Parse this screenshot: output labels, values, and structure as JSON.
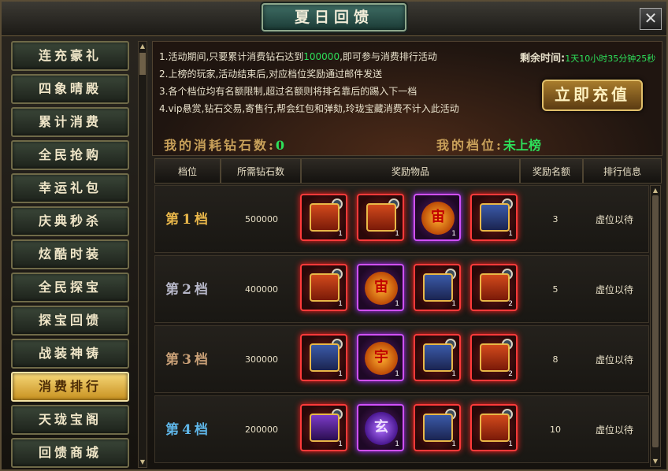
{
  "window": {
    "title": "夏日回馈",
    "close_label": "✕"
  },
  "menu": {
    "items": [
      {
        "label": "连充豪礼",
        "active": false
      },
      {
        "label": "四象晴殿",
        "active": false
      },
      {
        "label": "累计消费",
        "active": false
      },
      {
        "label": "全民抢购",
        "active": false
      },
      {
        "label": "幸运礼包",
        "active": false
      },
      {
        "label": "庆典秒杀",
        "active": false
      },
      {
        "label": "炫酷时装",
        "active": false
      },
      {
        "label": "全民探宝",
        "active": false
      },
      {
        "label": "探宝回馈",
        "active": false
      },
      {
        "label": "战装神铸",
        "active": false
      },
      {
        "label": "消费排行",
        "active": true
      },
      {
        "label": "天珑宝阁",
        "active": false
      },
      {
        "label": "回馈商城",
        "active": false
      }
    ]
  },
  "rules": {
    "line1_pre": "1.活动期间,只要累计消费钻石达到",
    "line1_num": "100000",
    "line1_post": ",即可参与消费排行活动",
    "line2": "2.上榜的玩家,活动结束后,对应档位奖励通过邮件发送",
    "line3": "3.各个档位均有名额限制,超过名额则将排名靠后的踢入下一档",
    "line4": "4.vip悬赏,钻石交易,寄售行,帮会红包和弹劾,玲珑宝藏消费不计入此活动"
  },
  "timer": {
    "label": "剩余时间:",
    "value": "1天10小时35分钟25秒"
  },
  "recharge_button": "立即充值",
  "my_spent": {
    "label": "我的消耗钻石数:",
    "value": "0"
  },
  "my_tier": {
    "label": "我的档位:",
    "value": "未上榜"
  },
  "table": {
    "headers": [
      "档位",
      "所需钻石数",
      "奖励物品",
      "奖励名额",
      "排行信息"
    ],
    "rows": [
      {
        "tier": "第1档",
        "tier_color": "#e8b64a",
        "cost": "500000",
        "quota": "3",
        "status": "虚位以待",
        "rewards": [
          {
            "frame": "red",
            "icon": "chest-red",
            "count": "1"
          },
          {
            "frame": "red",
            "icon": "chest-red",
            "count": "1"
          },
          {
            "frame": "purple",
            "icon": "rune-orange",
            "glyph": "宙",
            "count": "1"
          },
          {
            "frame": "red",
            "icon": "chest-blue",
            "count": "1"
          }
        ]
      },
      {
        "tier": "第2档",
        "tier_color": "#b7b7c8",
        "cost": "400000",
        "quota": "5",
        "status": "虚位以待",
        "rewards": [
          {
            "frame": "red",
            "icon": "chest-red",
            "count": "1"
          },
          {
            "frame": "purple",
            "icon": "rune-orange",
            "glyph": "宙",
            "count": "1"
          },
          {
            "frame": "red",
            "icon": "chest-blue",
            "count": "1"
          },
          {
            "frame": "red",
            "icon": "chest-red",
            "count": "2"
          }
        ]
      },
      {
        "tier": "第3档",
        "tier_color": "#c9a077",
        "cost": "300000",
        "quota": "8",
        "status": "虚位以待",
        "rewards": [
          {
            "frame": "red",
            "icon": "chest-blue",
            "count": "1"
          },
          {
            "frame": "purple",
            "icon": "rune-orange",
            "glyph": "宇",
            "count": "1"
          },
          {
            "frame": "red",
            "icon": "chest-blue",
            "count": "1"
          },
          {
            "frame": "red",
            "icon": "chest-red",
            "count": "2"
          }
        ]
      },
      {
        "tier": "第4档",
        "tier_color": "#5fb6e8",
        "cost": "200000",
        "quota": "10",
        "status": "虚位以待",
        "rewards": [
          {
            "frame": "red",
            "icon": "chest-purple",
            "count": "1"
          },
          {
            "frame": "purple",
            "icon": "rune-violet",
            "glyph": "玄",
            "count": "1"
          },
          {
            "frame": "red",
            "icon": "chest-blue",
            "count": "1"
          },
          {
            "frame": "red",
            "icon": "chest-red",
            "count": "1"
          }
        ]
      }
    ]
  }
}
